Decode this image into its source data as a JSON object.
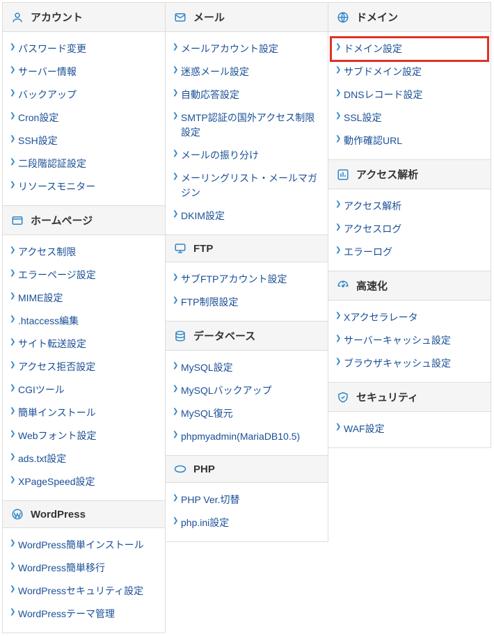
{
  "columns": [
    [
      {
        "id": "account",
        "icon": "user-icon",
        "title": "アカウント",
        "items": [
          {
            "label": "パスワード変更"
          },
          {
            "label": "サーバー情報"
          },
          {
            "label": "バックアップ"
          },
          {
            "label": "Cron設定"
          },
          {
            "label": "SSH設定"
          },
          {
            "label": "二段階認証設定"
          },
          {
            "label": "リソースモニター"
          }
        ]
      },
      {
        "id": "homepage",
        "icon": "window-icon",
        "title": "ホームページ",
        "items": [
          {
            "label": "アクセス制限"
          },
          {
            "label": "エラーページ設定"
          },
          {
            "label": "MIME設定"
          },
          {
            "label": ".htaccess編集"
          },
          {
            "label": "サイト転送設定"
          },
          {
            "label": "アクセス拒否設定"
          },
          {
            "label": "CGIツール"
          },
          {
            "label": "簡単インストール"
          },
          {
            "label": "Webフォント設定"
          },
          {
            "label": "ads.txt設定"
          },
          {
            "label": "XPageSpeed設定"
          }
        ]
      },
      {
        "id": "wordpress",
        "icon": "wordpress-icon",
        "title": "WordPress",
        "items": [
          {
            "label": "WordPress簡単インストール"
          },
          {
            "label": "WordPress簡単移行"
          },
          {
            "label": "WordPressセキュリティ設定"
          },
          {
            "label": "WordPressテーマ管理"
          }
        ]
      }
    ],
    [
      {
        "id": "mail",
        "icon": "mail-icon",
        "title": "メール",
        "items": [
          {
            "label": "メールアカウント設定"
          },
          {
            "label": "迷惑メール設定"
          },
          {
            "label": "自動応答設定"
          },
          {
            "label": "SMTP認証の国外アクセス制限設定"
          },
          {
            "label": "メールの振り分け"
          },
          {
            "label": "メーリングリスト・メールマガジン"
          },
          {
            "label": "DKIM設定"
          }
        ]
      },
      {
        "id": "ftp",
        "icon": "ftp-icon",
        "title": "FTP",
        "items": [
          {
            "label": "サブFTPアカウント設定"
          },
          {
            "label": "FTP制限設定"
          }
        ]
      },
      {
        "id": "database",
        "icon": "database-icon",
        "title": "データベース",
        "items": [
          {
            "label": "MySQL設定"
          },
          {
            "label": "MySQLバックアップ"
          },
          {
            "label": "MySQL復元"
          },
          {
            "label": "phpmyadmin(MariaDB10.5)"
          }
        ]
      },
      {
        "id": "php",
        "icon": "php-icon",
        "title": "PHP",
        "items": [
          {
            "label": "PHP Ver.切替"
          },
          {
            "label": "php.ini設定"
          }
        ]
      }
    ],
    [
      {
        "id": "domain",
        "icon": "globe-icon",
        "title": "ドメイン",
        "items": [
          {
            "label": "ドメイン設定",
            "highlight": true
          },
          {
            "label": "サブドメイン設定"
          },
          {
            "label": "DNSレコード設定"
          },
          {
            "label": "SSL設定"
          },
          {
            "label": "動作確認URL"
          }
        ]
      },
      {
        "id": "access",
        "icon": "chart-icon",
        "title": "アクセス解析",
        "items": [
          {
            "label": "アクセス解析"
          },
          {
            "label": "アクセスログ"
          },
          {
            "label": "エラーログ"
          }
        ]
      },
      {
        "id": "speed",
        "icon": "speed-icon",
        "title": "高速化",
        "items": [
          {
            "label": "Xアクセラレータ"
          },
          {
            "label": "サーバーキャッシュ設定"
          },
          {
            "label": "ブラウザキャッシュ設定"
          }
        ]
      },
      {
        "id": "security",
        "icon": "shield-icon",
        "title": "セキュリティ",
        "items": [
          {
            "label": "WAF設定"
          }
        ]
      }
    ]
  ]
}
